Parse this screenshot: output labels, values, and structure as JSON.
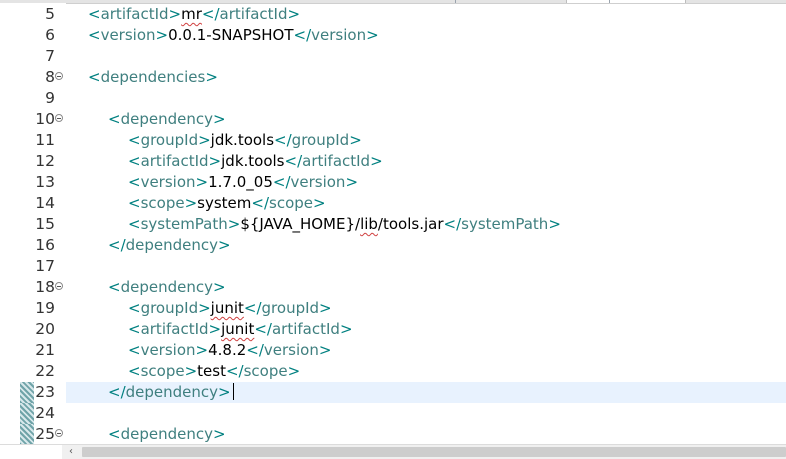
{
  "editor": {
    "lines": [
      {
        "n": "5",
        "indent": 0,
        "fold": false,
        "current": false,
        "change": false,
        "tokens": [
          {
            "c": "brk",
            "t": "<"
          },
          {
            "c": "tag",
            "t": "artifactId"
          },
          {
            "c": "brk",
            "t": ">"
          },
          {
            "c": "txt",
            "t": "mr",
            "spell": true
          },
          {
            "c": "brk",
            "t": "</"
          },
          {
            "c": "tag",
            "t": "artifactId"
          },
          {
            "c": "brk",
            "t": ">"
          }
        ]
      },
      {
        "n": "6",
        "indent": 0,
        "fold": false,
        "current": false,
        "change": false,
        "tokens": [
          {
            "c": "brk",
            "t": "<"
          },
          {
            "c": "tag",
            "t": "version"
          },
          {
            "c": "brk",
            "t": ">"
          },
          {
            "c": "txt",
            "t": "0.0.1-SNAPSHOT"
          },
          {
            "c": "brk",
            "t": "</"
          },
          {
            "c": "tag",
            "t": "version"
          },
          {
            "c": "brk",
            "t": ">"
          }
        ]
      },
      {
        "n": "7",
        "indent": 0,
        "fold": false,
        "current": false,
        "change": false,
        "tokens": []
      },
      {
        "n": "8",
        "indent": 0,
        "fold": true,
        "current": false,
        "change": false,
        "tokens": [
          {
            "c": "brk",
            "t": "<"
          },
          {
            "c": "tag",
            "t": "dependencies"
          },
          {
            "c": "brk",
            "t": ">"
          }
        ]
      },
      {
        "n": "9",
        "indent": 0,
        "fold": false,
        "current": false,
        "change": false,
        "tokens": []
      },
      {
        "n": "10",
        "indent": 1,
        "fold": true,
        "current": false,
        "change": false,
        "tokens": [
          {
            "c": "brk",
            "t": "<"
          },
          {
            "c": "tag",
            "t": "dependency"
          },
          {
            "c": "brk",
            "t": ">"
          }
        ]
      },
      {
        "n": "11",
        "indent": 2,
        "fold": false,
        "current": false,
        "change": false,
        "tokens": [
          {
            "c": "brk",
            "t": "<"
          },
          {
            "c": "tag",
            "t": "groupId"
          },
          {
            "c": "brk",
            "t": ">"
          },
          {
            "c": "txt",
            "t": "jdk.tools"
          },
          {
            "c": "brk",
            "t": "</"
          },
          {
            "c": "tag",
            "t": "groupId"
          },
          {
            "c": "brk",
            "t": ">"
          }
        ]
      },
      {
        "n": "12",
        "indent": 2,
        "fold": false,
        "current": false,
        "change": false,
        "tokens": [
          {
            "c": "brk",
            "t": "<"
          },
          {
            "c": "tag",
            "t": "artifactId"
          },
          {
            "c": "brk",
            "t": ">"
          },
          {
            "c": "txt",
            "t": "jdk.tools"
          },
          {
            "c": "brk",
            "t": "</"
          },
          {
            "c": "tag",
            "t": "artifactId"
          },
          {
            "c": "brk",
            "t": ">"
          }
        ]
      },
      {
        "n": "13",
        "indent": 2,
        "fold": false,
        "current": false,
        "change": false,
        "tokens": [
          {
            "c": "brk",
            "t": "<"
          },
          {
            "c": "tag",
            "t": "version"
          },
          {
            "c": "brk",
            "t": ">"
          },
          {
            "c": "txt",
            "t": "1.7.0_05"
          },
          {
            "c": "brk",
            "t": "</"
          },
          {
            "c": "tag",
            "t": "version"
          },
          {
            "c": "brk",
            "t": ">"
          }
        ]
      },
      {
        "n": "14",
        "indent": 2,
        "fold": false,
        "current": false,
        "change": false,
        "tokens": [
          {
            "c": "brk",
            "t": "<"
          },
          {
            "c": "tag",
            "t": "scope"
          },
          {
            "c": "brk",
            "t": ">"
          },
          {
            "c": "txt",
            "t": "system"
          },
          {
            "c": "brk",
            "t": "</"
          },
          {
            "c": "tag",
            "t": "scope"
          },
          {
            "c": "brk",
            "t": ">"
          }
        ]
      },
      {
        "n": "15",
        "indent": 2,
        "fold": false,
        "current": false,
        "change": false,
        "tokens": [
          {
            "c": "brk",
            "t": "<"
          },
          {
            "c": "tag",
            "t": "systemPath"
          },
          {
            "c": "brk",
            "t": ">"
          },
          {
            "c": "txt",
            "t": "${JAVA_HOME}/"
          },
          {
            "c": "txt",
            "t": "lib",
            "spell": true
          },
          {
            "c": "txt",
            "t": "/tools.jar"
          },
          {
            "c": "brk",
            "t": "</"
          },
          {
            "c": "tag",
            "t": "systemPath"
          },
          {
            "c": "brk",
            "t": ">"
          }
        ]
      },
      {
        "n": "16",
        "indent": 1,
        "fold": false,
        "current": false,
        "change": false,
        "tokens": [
          {
            "c": "brk",
            "t": "</"
          },
          {
            "c": "tag",
            "t": "dependency"
          },
          {
            "c": "brk",
            "t": ">"
          }
        ]
      },
      {
        "n": "17",
        "indent": 0,
        "fold": false,
        "current": false,
        "change": false,
        "tokens": []
      },
      {
        "n": "18",
        "indent": 1,
        "fold": true,
        "current": false,
        "change": false,
        "tokens": [
          {
            "c": "brk",
            "t": "<"
          },
          {
            "c": "tag",
            "t": "dependency"
          },
          {
            "c": "brk",
            "t": ">"
          }
        ]
      },
      {
        "n": "19",
        "indent": 2,
        "fold": false,
        "current": false,
        "change": false,
        "tokens": [
          {
            "c": "brk",
            "t": "<"
          },
          {
            "c": "tag",
            "t": "groupId"
          },
          {
            "c": "brk",
            "t": ">"
          },
          {
            "c": "txt",
            "t": "junit",
            "spell": true
          },
          {
            "c": "brk",
            "t": "</"
          },
          {
            "c": "tag",
            "t": "groupId"
          },
          {
            "c": "brk",
            "t": ">"
          }
        ]
      },
      {
        "n": "20",
        "indent": 2,
        "fold": false,
        "current": false,
        "change": false,
        "tokens": [
          {
            "c": "brk",
            "t": "<"
          },
          {
            "c": "tag",
            "t": "artifactId"
          },
          {
            "c": "brk",
            "t": ">"
          },
          {
            "c": "txt",
            "t": "junit",
            "spell": true
          },
          {
            "c": "brk",
            "t": "</"
          },
          {
            "c": "tag",
            "t": "artifactId"
          },
          {
            "c": "brk",
            "t": ">"
          }
        ]
      },
      {
        "n": "21",
        "indent": 2,
        "fold": false,
        "current": false,
        "change": false,
        "tokens": [
          {
            "c": "brk",
            "t": "<"
          },
          {
            "c": "tag",
            "t": "version"
          },
          {
            "c": "brk",
            "t": ">"
          },
          {
            "c": "txt",
            "t": "4.8.2"
          },
          {
            "c": "brk",
            "t": "</"
          },
          {
            "c": "tag",
            "t": "version"
          },
          {
            "c": "brk",
            "t": ">"
          }
        ]
      },
      {
        "n": "22",
        "indent": 2,
        "fold": false,
        "current": false,
        "change": false,
        "tokens": [
          {
            "c": "brk",
            "t": "<"
          },
          {
            "c": "tag",
            "t": "scope"
          },
          {
            "c": "brk",
            "t": ">"
          },
          {
            "c": "txt",
            "t": "test"
          },
          {
            "c": "brk",
            "t": "</"
          },
          {
            "c": "tag",
            "t": "scope"
          },
          {
            "c": "brk",
            "t": ">"
          }
        ]
      },
      {
        "n": "23",
        "indent": 1,
        "fold": false,
        "current": true,
        "change": true,
        "caret": true,
        "tokens": [
          {
            "c": "brk",
            "t": "</"
          },
          {
            "c": "tag",
            "t": "dependency"
          },
          {
            "c": "brk",
            "t": ">"
          }
        ]
      },
      {
        "n": "24",
        "indent": 0,
        "fold": false,
        "current": false,
        "change": true,
        "tokens": []
      },
      {
        "n": "25",
        "indent": 1,
        "fold": true,
        "current": false,
        "change": true,
        "tokens": [
          {
            "c": "brk",
            "t": "<"
          },
          {
            "c": "tag",
            "t": "dependency"
          },
          {
            "c": "brk",
            "t": ">"
          }
        ]
      }
    ]
  },
  "icons": {
    "scroll_left": "‹"
  },
  "colors": {
    "tag": "#3f7f7f",
    "bracket": "#008080",
    "text": "#000000",
    "current_line": "#e8f2fe",
    "spelling": "#d04040"
  }
}
